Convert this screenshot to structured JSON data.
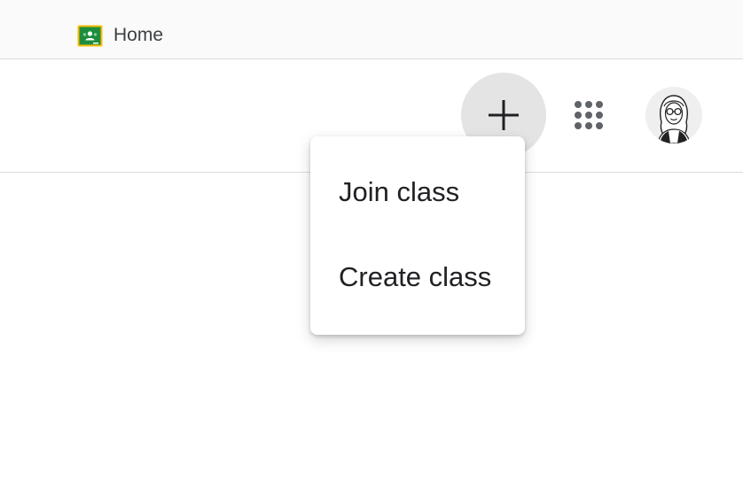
{
  "tab": {
    "title": "Home",
    "favicon": "google-classroom-icon"
  },
  "header": {
    "add_icon": "plus-icon",
    "apps_icon": "apps-grid-icon",
    "avatar_icon": "user-avatar"
  },
  "menu": {
    "items": [
      {
        "label": "Join class"
      },
      {
        "label": "Create class"
      }
    ]
  },
  "colors": {
    "classroom_green": "#1e8e3e",
    "classroom_yellow": "#fbbc04",
    "icon_gray": "#5f6368",
    "add_button_bg": "#e4e4e4"
  }
}
